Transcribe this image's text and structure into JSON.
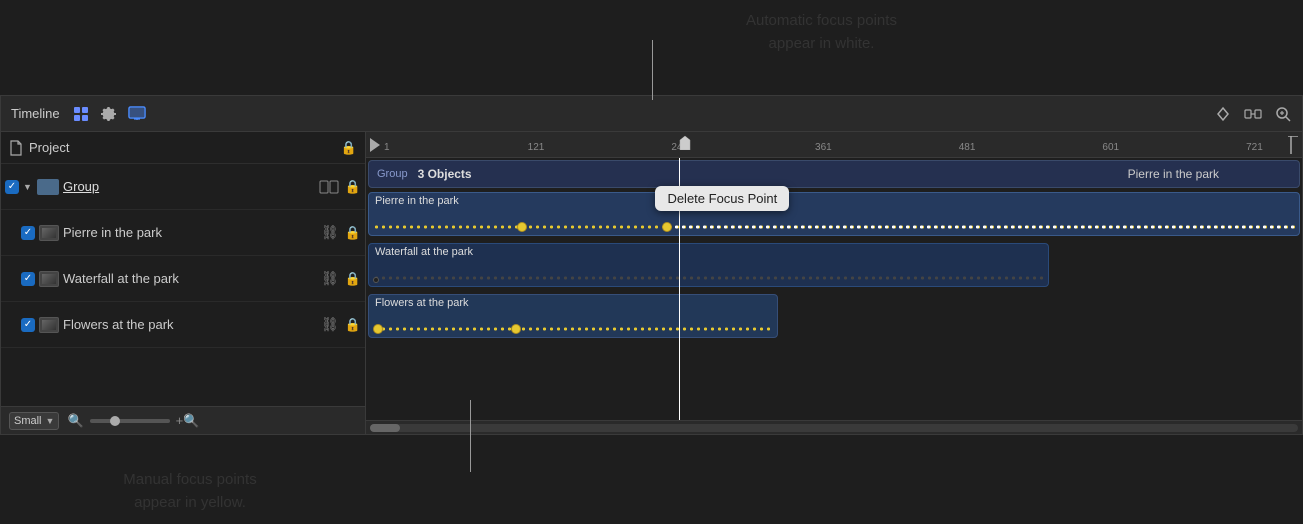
{
  "annotations": {
    "top_line1": "Automatic focus points",
    "top_line2": "appear in white.",
    "bottom_line1": "Manual focus points",
    "bottom_line2": "appear in yellow."
  },
  "timeline": {
    "title": "Timeline",
    "header_icons": [
      "mosaic-icon",
      "gear-icon",
      "monitor-icon"
    ],
    "right_icons": [
      "diamond-icon",
      "split-icon",
      "zoom-in-icon"
    ]
  },
  "sidebar": {
    "project_label": "Project",
    "group_label": "Group",
    "items": [
      {
        "label": "Pierre in the park",
        "checked": true
      },
      {
        "label": "Waterfall at the park",
        "checked": true
      },
      {
        "label": "Flowers at the park",
        "checked": true
      }
    ]
  },
  "ruler": {
    "marks": [
      1,
      121,
      241,
      361,
      481,
      601,
      721
    ]
  },
  "tracks": {
    "group_bar": {
      "label": "Group",
      "count": "3 Objects",
      "name": "Pierre in the park"
    },
    "pierre": {
      "label": "Pierre in the park"
    },
    "waterfall": {
      "label": "Waterfall at the park"
    },
    "flowers": {
      "label": "Flowers at the park"
    }
  },
  "popup": {
    "label": "Delete Focus Point"
  },
  "bottom": {
    "size_label": "Small",
    "zoom_icon_minus": "🔍",
    "zoom_icon_plus": "🔍"
  }
}
